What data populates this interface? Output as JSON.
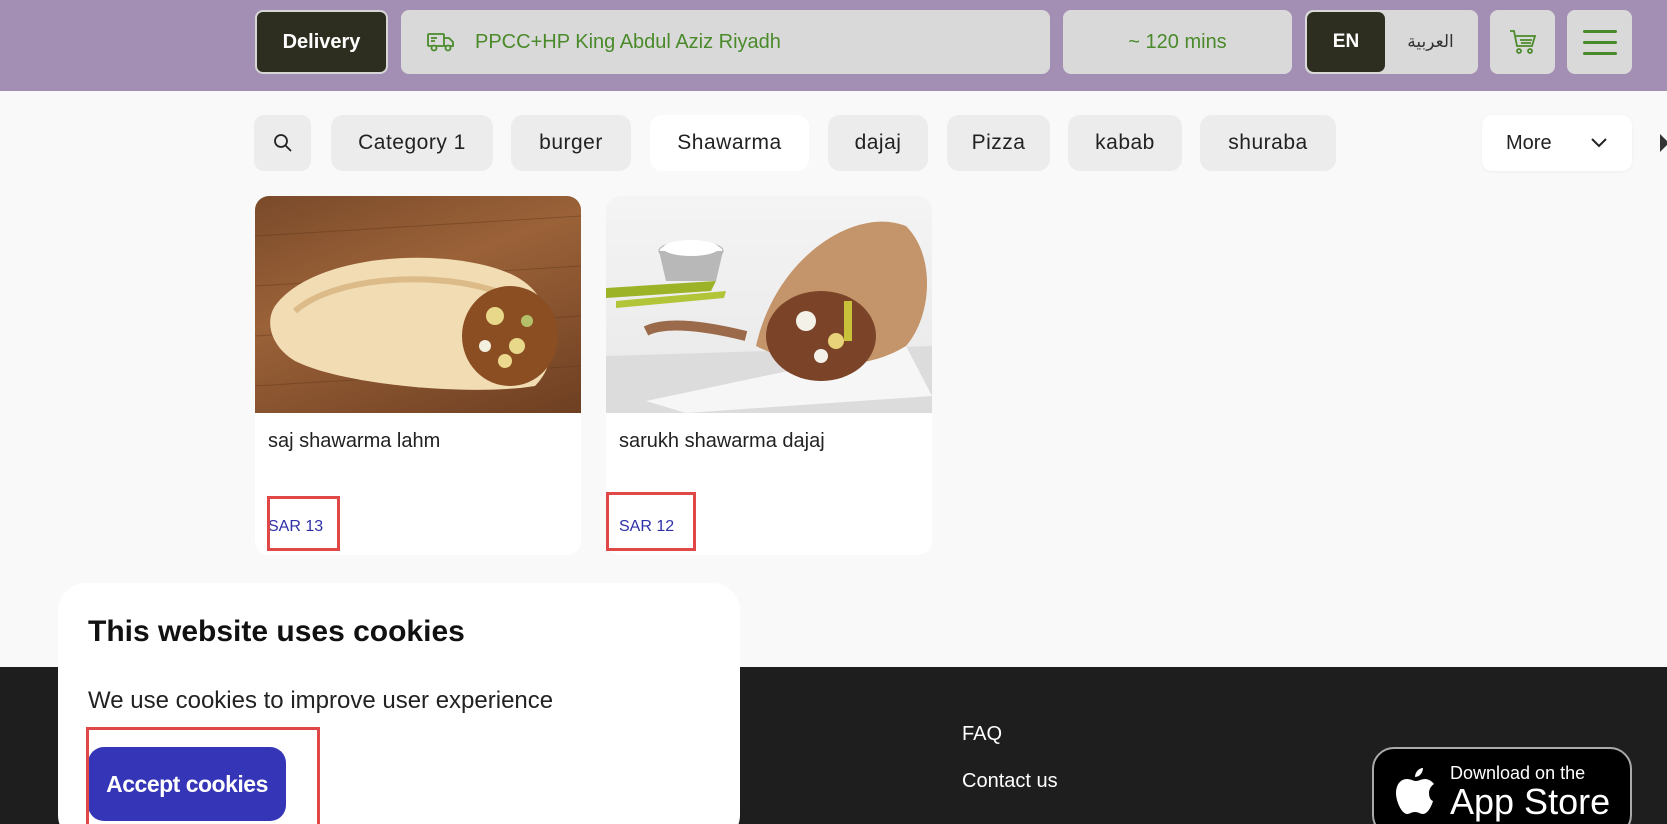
{
  "header": {
    "delivery_label": "Delivery",
    "address": "PPCC+HP King Abdul Aziz Riyadh",
    "eta": "~ 120 mins",
    "lang_en": "EN",
    "lang_ar": "العربية"
  },
  "categories": [
    "Category 1",
    "burger",
    "Shawarma",
    "dajaj",
    "Pizza",
    "kabab",
    "shuraba"
  ],
  "active_category": "Shawarma",
  "more_label": "More",
  "products": [
    {
      "name": "saj shawarma lahm",
      "price": "SAR 13"
    },
    {
      "name": "sarukh shawarma dajaj",
      "price": "SAR 12"
    }
  ],
  "footer": {
    "links": [
      "FAQ",
      "Contact us"
    ],
    "appstore_small": "Download on the",
    "appstore_big": "App Store"
  },
  "cookie": {
    "title": "This website uses cookies",
    "text": "We use cookies to improve user experience",
    "accept_label": "Accept cookies"
  },
  "colors": {
    "header_bg": "#a48fb4",
    "dark_btn": "#2d2e20",
    "accent_green": "#4a8a2a",
    "price_blue": "#2f2fa8",
    "accept_blue": "#3535b8",
    "footer_bg": "#1e1e1e"
  }
}
